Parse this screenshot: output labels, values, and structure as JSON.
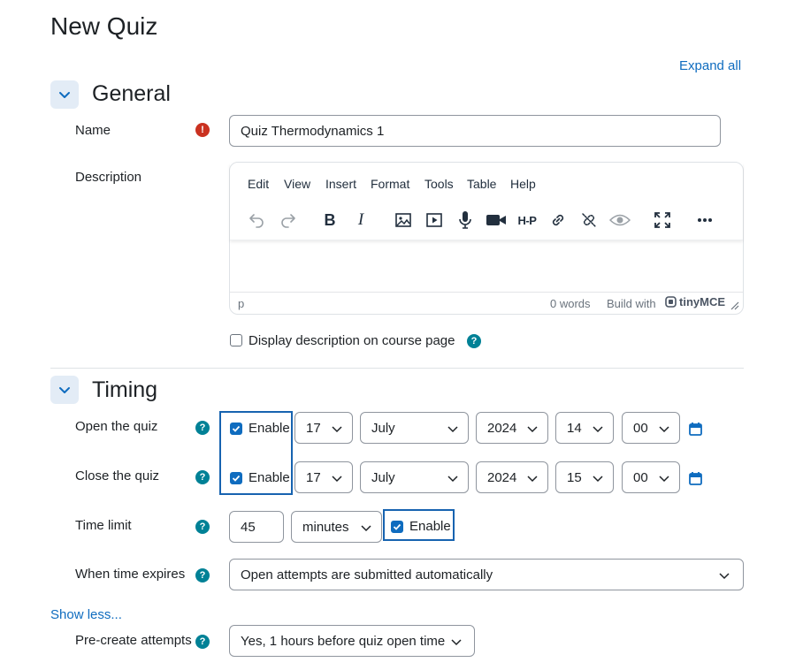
{
  "page": {
    "title": "New Quiz",
    "expand_all": "Expand all"
  },
  "general": {
    "title": "General",
    "name_label": "Name",
    "name_value": "Quiz Thermodynamics 1",
    "description_label": "Description",
    "editor": {
      "menu": [
        "Edit",
        "View",
        "Insert",
        "Format",
        "Tools",
        "Table",
        "Help"
      ],
      "status_path": "p",
      "word_count": "0 words",
      "build_with": "Build with",
      "brand": "tinyMCE"
    },
    "display_description_label": "Display description on course page"
  },
  "timing": {
    "title": "Timing",
    "open": {
      "label": "Open the quiz",
      "enable": "Enable",
      "day": "17",
      "month": "July",
      "year": "2024",
      "hour": "14",
      "minute": "00"
    },
    "close": {
      "label": "Close the quiz",
      "enable": "Enable",
      "day": "17",
      "month": "July",
      "year": "2024",
      "hour": "15",
      "minute": "00"
    },
    "time_limit": {
      "label": "Time limit",
      "value": "45",
      "unit": "minutes",
      "enable": "Enable"
    },
    "when_expires": {
      "label": "When time expires",
      "value": "Open attempts are submitted automatically"
    },
    "show_less": "Show less...",
    "precreate": {
      "label": "Pre-create attempts",
      "value": "Yes, 1 hours before quiz open time"
    }
  },
  "colors": {
    "link": "#0f6cbf",
    "help": "#008196",
    "required": "#ca3120",
    "highlight": "#1763b0"
  }
}
